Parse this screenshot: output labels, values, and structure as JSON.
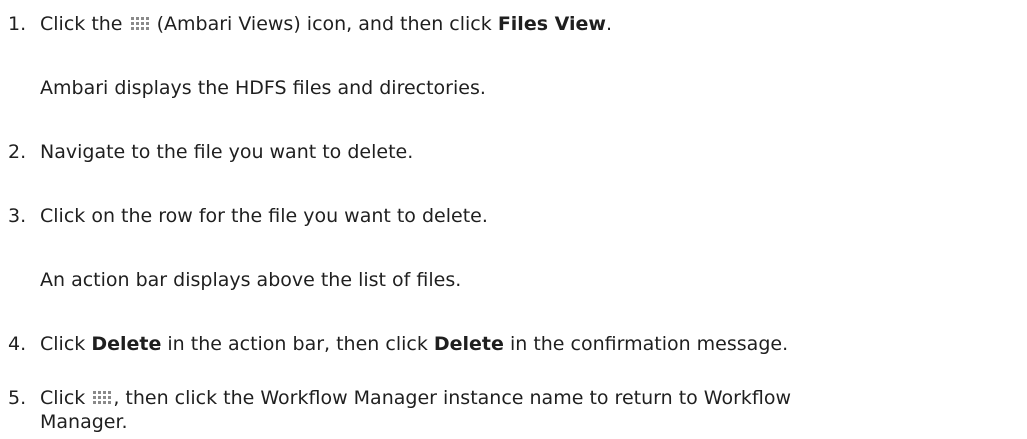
{
  "steps": [
    {
      "num": "1.",
      "pre": "Click the",
      "icon": "grid-icon",
      "mid": "(Ambari Views) icon, and then click",
      "bold": "Files View",
      "post": ".",
      "note": "Ambari displays the HDFS files and directories."
    },
    {
      "num": "2.",
      "text": "Navigate to the file you want to delete."
    },
    {
      "num": "3.",
      "text": "Click on the row for the file you want to delete.",
      "note": "An action bar displays above the list of files."
    },
    {
      "num": "4.",
      "pre": "Click",
      "bold1": "Delete",
      "mid": "in the action bar, then click",
      "bold2": "Delete",
      "post": "in the confirmation message."
    },
    {
      "num": "5.",
      "pre": "Click",
      "icon": "grid-icon",
      "post": ", then click the Workflow Manager instance name to return to Workflow",
      "post2": "Manager."
    }
  ],
  "colors": {
    "text": "#1f1f1f",
    "icon": "#8a8a8a"
  }
}
